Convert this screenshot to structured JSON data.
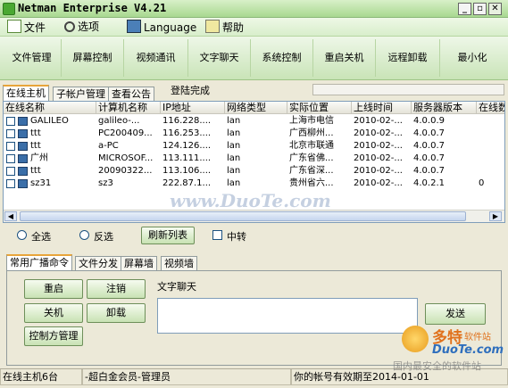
{
  "window": {
    "title": "Netman Enterprise V4.21",
    "min": "_",
    "max": "▫",
    "close": "✕"
  },
  "menu": [
    {
      "label": "文件",
      "icon": "file-icon"
    },
    {
      "label": "选项",
      "icon": "options-icon"
    },
    {
      "label": "Language",
      "icon": "language-icon"
    },
    {
      "label": "帮助",
      "icon": "help-icon"
    }
  ],
  "toolbar": [
    "文件管理",
    "屏幕控制",
    "视频通讯",
    "文字聊天",
    "系统控制",
    "重启关机",
    "远程卸载",
    "最小化"
  ],
  "tabs_top": [
    "在线主机",
    "子帐户管理",
    "查看公告"
  ],
  "login_status": "登陆完成",
  "grid": {
    "headers": [
      "在线名称",
      "计算机名称",
      "IP地址",
      "网络类型",
      "实际位置",
      "上线时间",
      "服务器版本",
      "在线数"
    ],
    "rows": [
      [
        "GALILEO",
        "galileo-...",
        "116.228....",
        "lan",
        "上海市电信",
        "2010-02-...",
        "4.0.0.9",
        ""
      ],
      [
        "ttt",
        "PC200409...",
        "116.253....",
        "lan",
        "广西柳州...",
        "2010-02-...",
        "4.0.0.7",
        ""
      ],
      [
        "ttt",
        "a-PC",
        "124.126....",
        "lan",
        "北京市联通",
        "2010-02-...",
        "4.0.0.7",
        ""
      ],
      [
        "广州",
        "MICROSOF...",
        "113.111....",
        "lan",
        "广东省佛...",
        "2010-02-...",
        "4.0.0.7",
        ""
      ],
      [
        "ttt",
        "20090322...",
        "113.106....",
        "lan",
        "广东省深...",
        "2010-02-...",
        "4.0.0.7",
        ""
      ],
      [
        "sz31",
        "sz3",
        "222.87.1...",
        "lan",
        "贵州省六...",
        "2010-02-...",
        "4.0.2.1",
        "0"
      ]
    ]
  },
  "select_all": "全选",
  "invert": "反选",
  "refresh": "刷新列表",
  "relay": "中转",
  "tabs_bottom": [
    "常用广播命令",
    "文件分发",
    "屏幕墙",
    "视频墙"
  ],
  "commands": {
    "restart": "重启",
    "logoff": "注销",
    "shutdown": "关机",
    "uninstall": "卸载",
    "console": "控制方管理"
  },
  "chat_label": "文字聊天",
  "send": "发送",
  "status": {
    "online": "在线主机6台",
    "member": "-超白金会员-管理员",
    "expiry": "你的帐号有效期至2014-01-01"
  },
  "watermark": {
    "main": "www.DuoTe.com",
    "brand": "多特",
    "sub": "软件站",
    "site": "DuoTe.com",
    "slogan": "国内最安全的软件站"
  }
}
